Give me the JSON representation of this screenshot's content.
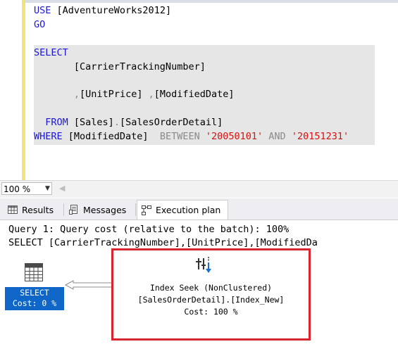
{
  "editor": {
    "lines": [
      {
        "parts": [
          {
            "t": "USE",
            "c": "kw"
          },
          {
            "t": " [AdventureWorks2012]",
            "c": ""
          }
        ]
      },
      {
        "parts": [
          {
            "t": "GO",
            "c": "kw"
          }
        ]
      },
      {
        "parts": [
          {
            "t": "SELECT",
            "c": "kw"
          }
        ]
      },
      {
        "parts": [
          {
            "t": "       [CarrierTrackingNumber]",
            "c": ""
          }
        ]
      },
      {
        "parts": [
          {
            "t": "       ",
            "c": ""
          },
          {
            "t": ",",
            "c": "gray"
          },
          {
            "t": "[UnitPrice] ",
            "c": ""
          },
          {
            "t": ",",
            "c": "gray"
          },
          {
            "t": "[ModifiedDate]",
            "c": ""
          }
        ]
      },
      {
        "parts": [
          {
            "t": "  FROM",
            "c": "kw"
          },
          {
            "t": " [Sales]",
            "c": ""
          },
          {
            "t": ".",
            "c": "gray"
          },
          {
            "t": "[SalesOrderDetail]",
            "c": ""
          }
        ]
      },
      {
        "parts": [
          {
            "t": "WHERE",
            "c": "kw"
          },
          {
            "t": " [ModifiedDate]  ",
            "c": ""
          },
          {
            "t": "BETWEEN",
            "c": "gray"
          },
          {
            "t": " ",
            "c": ""
          },
          {
            "t": "'20050101'",
            "c": "str"
          },
          {
            "t": " ",
            "c": ""
          },
          {
            "t": "AND",
            "c": "gray"
          },
          {
            "t": " ",
            "c": ""
          },
          {
            "t": "'20151231'",
            "c": "str"
          }
        ]
      }
    ]
  },
  "zoom": {
    "value": "100 %"
  },
  "tabs": {
    "results": "Results",
    "messages": "Messages",
    "execution_plan": "Execution plan"
  },
  "plan": {
    "query_header": "Query 1: Query cost (relative to the batch): 100%",
    "query_sql": "SELECT [CarrierTrackingNumber],[UnitPrice],[ModifiedDa",
    "select_node": {
      "label": "SELECT",
      "cost": "Cost: 0 %"
    },
    "seek_node": {
      "operation": "Index Seek (NonClustered)",
      "object": "[SalesOrderDetail].[Index_New]",
      "cost": "Cost: 100 %"
    }
  },
  "colors": {
    "keyword": "#1d18d6",
    "string": "#d21313",
    "operator": "#8a8a8a",
    "selected_node": "#0f66c6",
    "highlight_box": "#d9262e"
  }
}
